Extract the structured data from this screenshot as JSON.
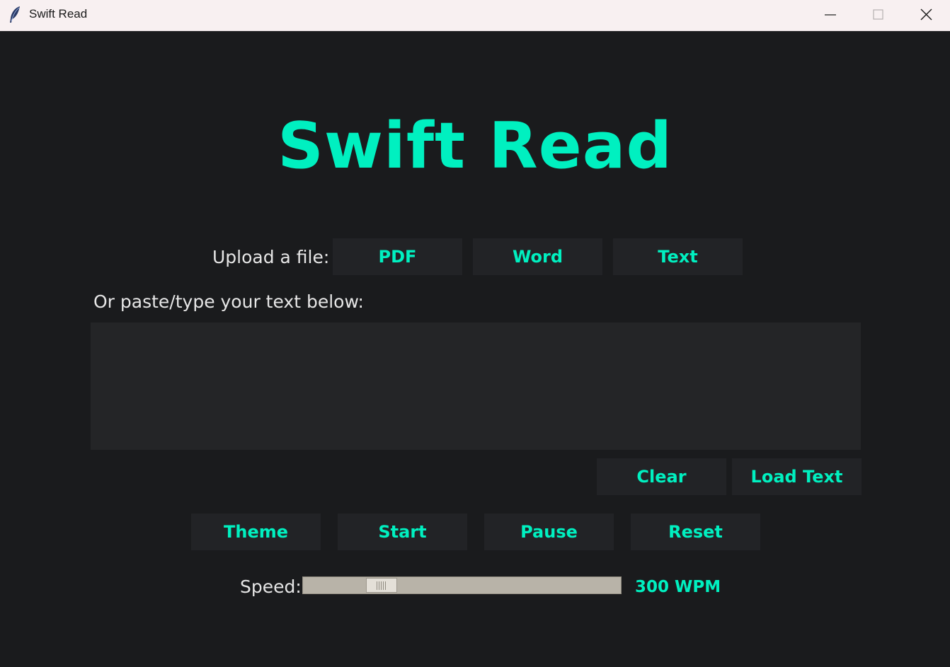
{
  "window": {
    "title": "Swift Read"
  },
  "app": {
    "title": "Swift Read",
    "upload_label": "Upload a file:",
    "paste_label": "Or paste/type your text below:",
    "text_input_value": "",
    "speed_label": "Speed:",
    "speed_value": "300 WPM",
    "speed_fraction": 0.22
  },
  "buttons": {
    "pdf": "PDF",
    "word": "Word",
    "text": "Text",
    "clear": "Clear",
    "load_text": "Load Text",
    "theme": "Theme",
    "start": "Start",
    "pause": "Pause",
    "reset": "Reset"
  },
  "icons": {
    "app": "feather-icon",
    "minimize": "minimize-icon",
    "maximize": "maximize-icon",
    "close": "close-icon"
  },
  "colors": {
    "accent": "#00f0c0",
    "background": "#1a1b1d",
    "button_bg": "#222326",
    "titlebar_bg": "#f8f0f1"
  }
}
